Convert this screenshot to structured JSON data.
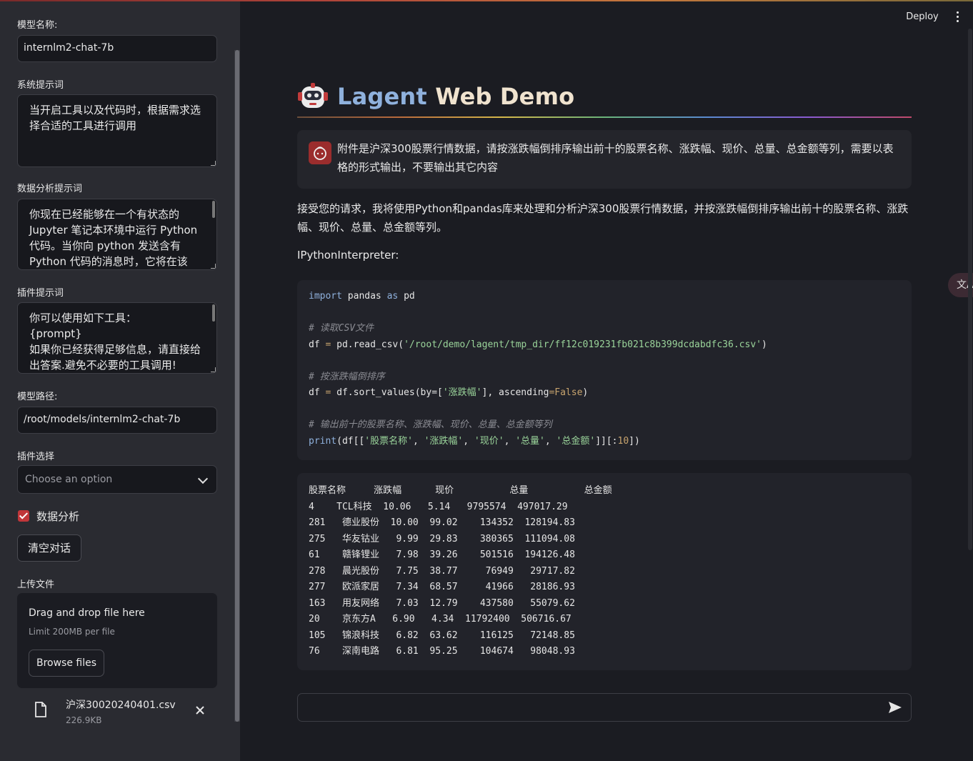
{
  "sidebar": {
    "model_name_label": "模型名称:",
    "model_name_value": "internlm2-chat-7b",
    "system_prompt_label": "系统提示词",
    "system_prompt_value": "当开启工具以及代码时，根据需求选择合适的工具进行调用",
    "da_prompt_label": "数据分析提示词",
    "da_prompt_value": "你现在已经能够在一个有状态的Jupyter 笔记本环境中运行 Python 代码。当你向 python 发送含有 Python 代码的消息时，它将在该",
    "plugin_prompt_label": "插件提示词",
    "plugin_prompt_value": "你可以使用如下工具：\n{prompt}\n如果你已经获得足够信息，请直接给出答案.避免不必要的工具调用!",
    "model_path_label": "模型路径:",
    "model_path_value": "/root/models/internlm2-chat-7b",
    "plugin_select_label": "插件选择",
    "plugin_select_placeholder": "Choose an option",
    "data_analysis_label": "数据分析",
    "clear_button": "清空对话",
    "upload_label": "上传文件",
    "upload_drag": "Drag and drop file here",
    "upload_limit": "Limit 200MB per file",
    "browse_button": "Browse files",
    "file_name": "沪深30020240401.csv",
    "file_size": "226.9KB"
  },
  "header": {
    "deploy": "Deploy",
    "title_highlight": "Lagent",
    "title_rest": " Web Demo"
  },
  "chat": {
    "user_message": "附件是沪深300股票行情数据，请按涨跌幅倒排序输出前十的股票名称、涨跌幅、现价、总量、总金额等列，需要以表格的形式输出，不要输出其它内容",
    "assistant_message": "接受您的请求，我将使用Python和pandas库来处理和分析沪深300股票行情数据，并按涨跌幅倒排序输出前十的股票名称、涨跌幅、现价、总量、总金额等列。",
    "tool_name": "IPythonInterpreter:",
    "side_tab": "文A"
  },
  "code": {
    "l1_kw1": "import",
    "l1_mod": " pandas ",
    "l1_kw2": "as",
    "l1_alias": " pd",
    "c1": "# 读取CSV文件",
    "l2_a": "df ",
    "l2_eq": "=",
    "l2_b": " pd.read_csv(",
    "l2_str": "'/root/demo/lagent/tmp_dir/ff12c019231fb021c8b399dcdabdfc36.csv'",
    "l2_c": ")",
    "c2": "# 按涨跌幅倒排序",
    "l3_a": "df ",
    "l3_eq": "=",
    "l3_b": " df.sort_values(by=[",
    "l3_str": "'涨跌幅'",
    "l3_c": "], ascending",
    "l3_eq2": "=",
    "l3_false": "False",
    "l3_d": ")",
    "c3": "# 输出前十的股票名称、涨跌幅、现价、总量、总金额等列",
    "l4_a": "print(df[[",
    "l4_s1": "'股票名称'",
    "l4_s2": "'涨跌幅'",
    "l4_s3": "'现价'",
    "l4_s4": "'总量'",
    "l4_s5": "'总金额'",
    "l4_b": "]][:",
    "l4_num": "10",
    "l4_c": "])",
    "sep": ", "
  },
  "output": {
    "header": "股票名称     涨跌幅      现价          总量          总金额",
    "rows": [
      "4    TCL科技  10.06   5.14   9795574  497017.29",
      "281   德业股份  10.00  99.02    134352  128194.83",
      "275   华友钴业   9.99  29.83    380365  111094.08",
      "61    赣锋锂业   7.98  39.26    501516  194126.48",
      "278   晨光股份   7.75  38.77     76949   29717.82",
      "277   欧派家居   7.34  68.57     41966   28186.93",
      "163   用友网络   7.03  12.79    437580   55079.62",
      "20    京东方A   6.90   4.34  11792400  506716.67",
      "105   锦浪科技   6.82  63.62    116125   72148.85",
      "76    深南电路   6.81  95.25    104674   98048.93"
    ]
  }
}
